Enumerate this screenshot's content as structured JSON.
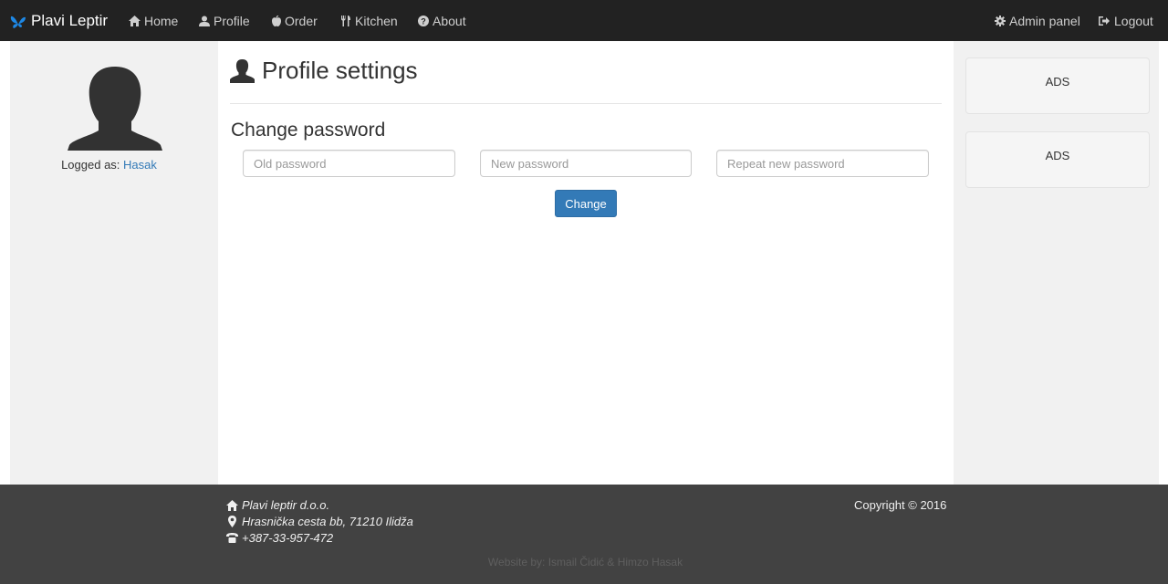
{
  "navbar": {
    "brand": "Plavi Leptir",
    "items": [
      {
        "label": "Home",
        "icon": "home-icon"
      },
      {
        "label": "Profile",
        "icon": "user-icon"
      },
      {
        "label": "Order",
        "icon": "apple-icon"
      },
      {
        "label": "Kitchen",
        "icon": "cutlery-icon"
      },
      {
        "label": "About",
        "icon": "question-circle-icon"
      }
    ],
    "right": [
      {
        "label": "Admin panel",
        "icon": "gear-icon"
      },
      {
        "label": "Logout",
        "icon": "logout-icon"
      }
    ]
  },
  "sidebar": {
    "logged_label": "Logged as:",
    "username": "Hasak"
  },
  "main": {
    "title": "Profile settings",
    "subtitle": "Change password",
    "inputs": {
      "old_placeholder": "Old password",
      "new_placeholder": "New password",
      "repeat_placeholder": "Repeat new password"
    },
    "button_label": "Change"
  },
  "ads": [
    "ADS",
    "ADS"
  ],
  "footer": {
    "company": "Plavi leptir d.o.o.",
    "address": "Hrasnička cesta bb, 71210 Ilidža",
    "phone": "+387-33-957-472",
    "copyright": "Copyright © 2016",
    "credits": "Website by: Ismail Čidić & Himzo Hasak"
  },
  "colors": {
    "navbar_bg": "#222222",
    "footer_bg": "#424242",
    "accent": "#337ab7",
    "brand_icon": "#1e88e5"
  }
}
